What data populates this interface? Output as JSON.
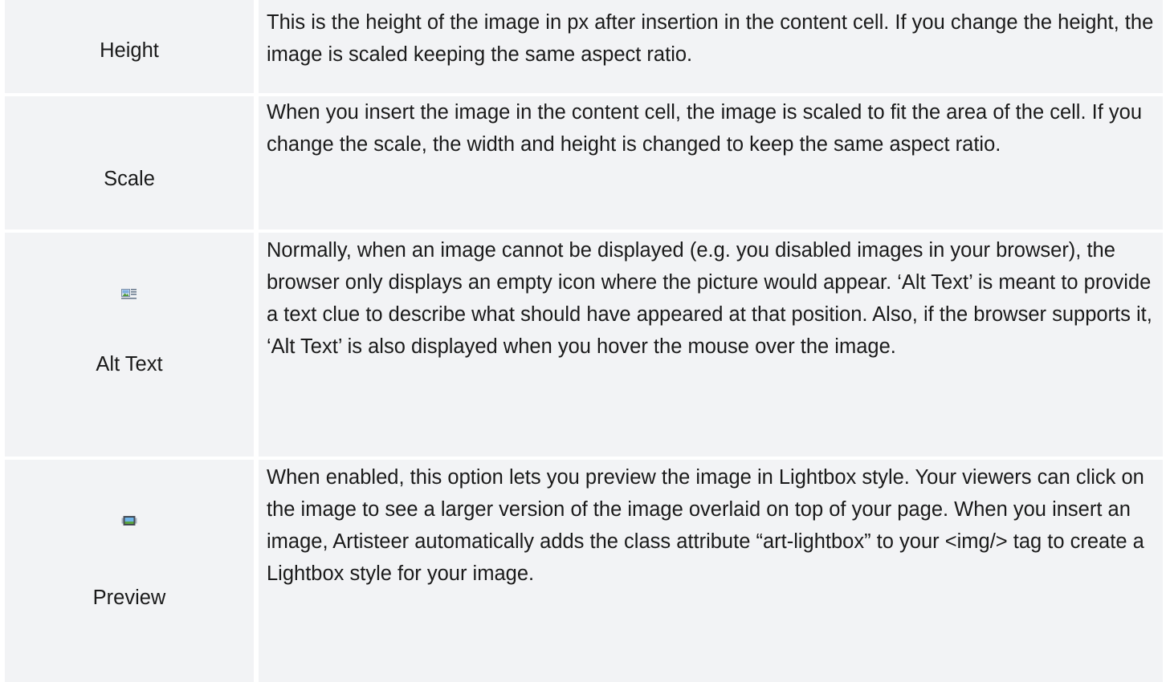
{
  "rows": [
    {
      "label": "Height",
      "icon": "",
      "description": "This is the height of the image in px after insertion in the content cell.  If you change the height, the image is scaled keeping the same aspect ratio."
    },
    {
      "label": "Scale",
      "icon": "",
      "description": "When you insert the image in the content cell, the image is scaled to fit the area of the cell.  If you change the scale, the width and height is changed to keep the same aspect ratio."
    },
    {
      "label": "Alt Text",
      "icon": "alt-text-icon",
      "description": "Normally, when an image cannot be displayed (e.g. you disabled images in your browser), the browser only displays an empty icon where the picture would appear.  ‘Alt Text’ is meant to provide a text clue to describe what should have appeared at that position.  Also, if the browser supports it, ‘Alt Text’ is also displayed when you hover the mouse over the image."
    },
    {
      "label": "Preview",
      "icon": "image-preview-icon",
      "description": "When enabled, this option lets you preview the image in Lightbox style. Your viewers can click on the image to see a larger version of the image overlaid on top of your page. When you insert an image, Artisteer automatically adds the class attribute “art-lightbox” to your <img/> tag to create a Lightbox style for your image."
    }
  ],
  "colors": {
    "cell_background": "#f2f3f5",
    "text": "#1a1a1a"
  }
}
